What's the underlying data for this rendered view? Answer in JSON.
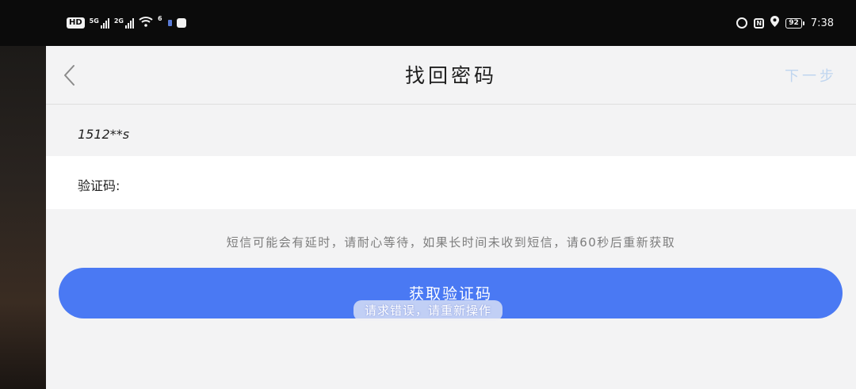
{
  "status_bar": {
    "hd": "HD",
    "sim1": "5G",
    "sim2": "2G",
    "wifi_label": "6",
    "battery": "92",
    "time": "7:38"
  },
  "header": {
    "title": "找回密码",
    "next": "下一步"
  },
  "form": {
    "phone": "1512**s",
    "code_label": "验证码:",
    "code_value": ""
  },
  "hint": "短信可能会有延时，请耐心等待，如果长时间未收到短信，请60秒后重新获取",
  "button": {
    "label": "获取验证码"
  },
  "toast": "请求错误，请重新操作",
  "colors": {
    "primary": "#4a79f3",
    "next_disabled": "#bfd5ef",
    "background": "#f3f3f4"
  }
}
